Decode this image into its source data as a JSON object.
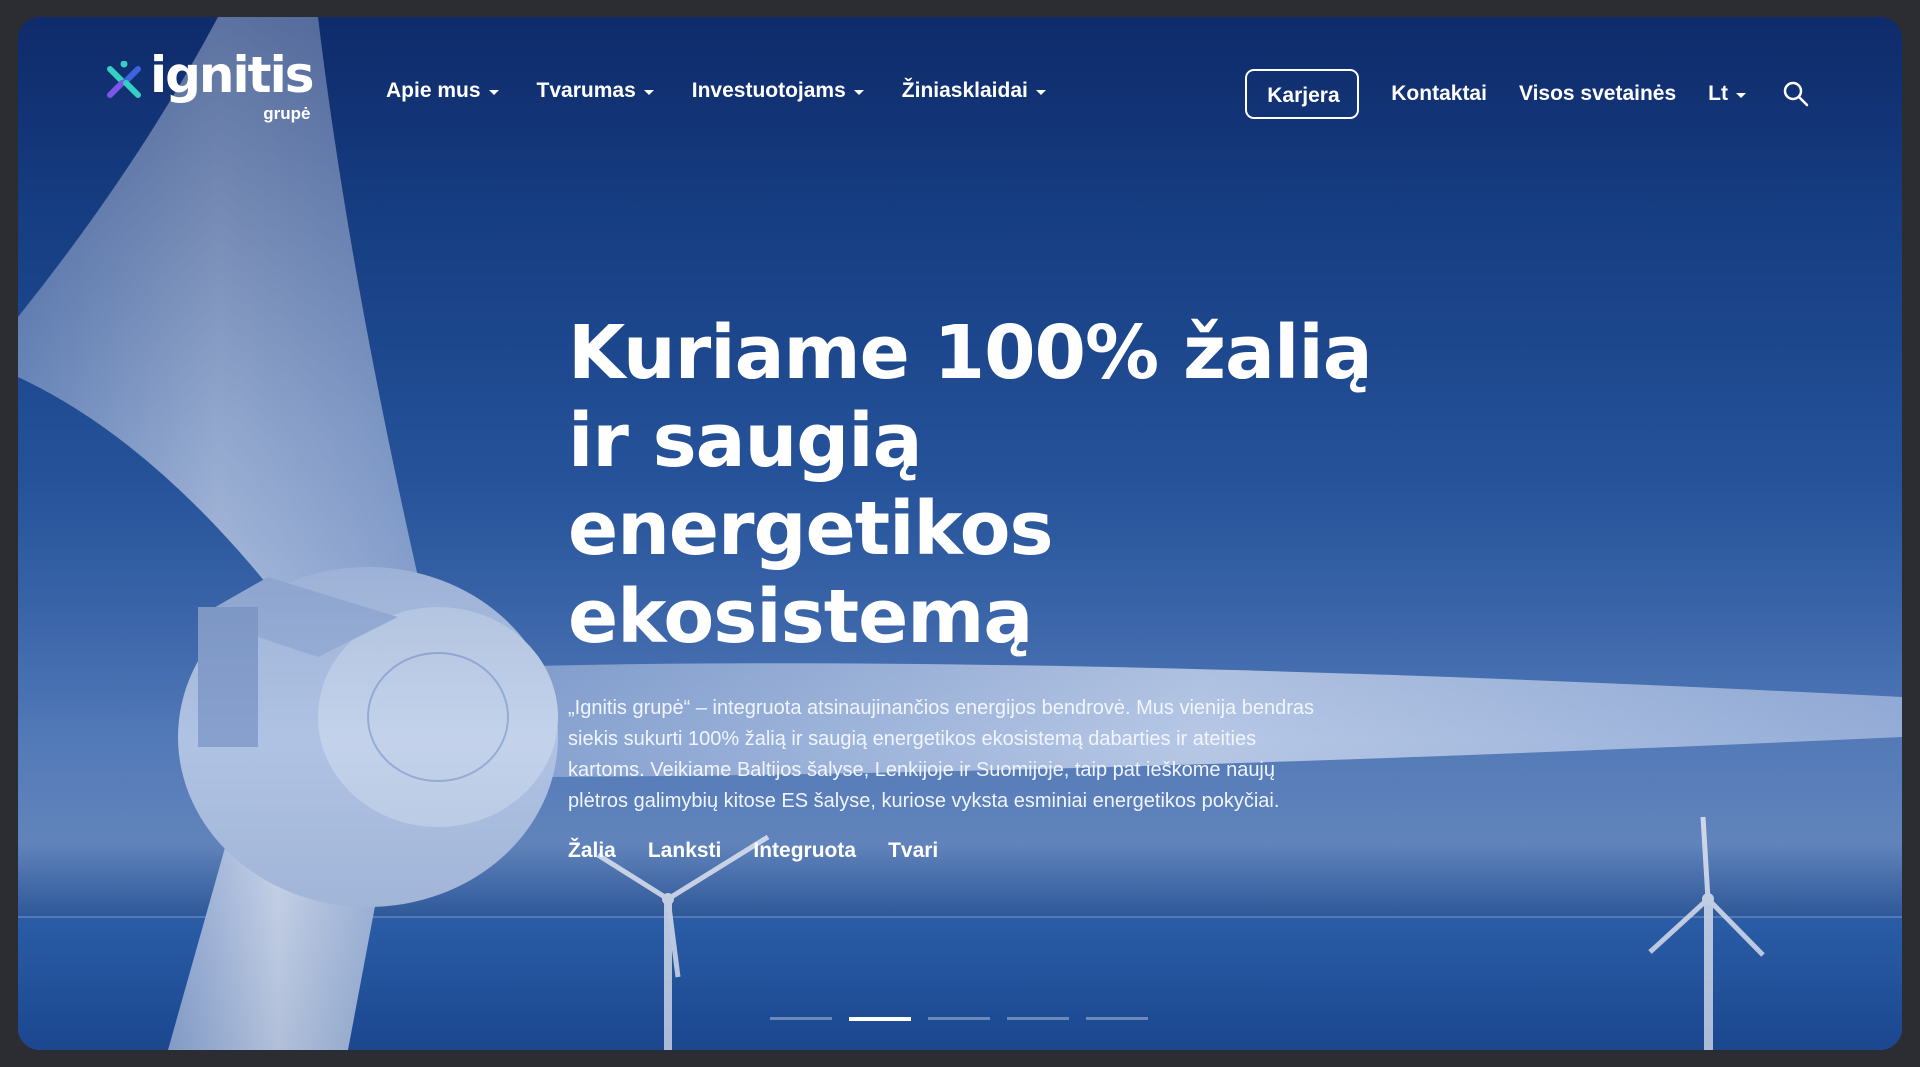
{
  "brand": {
    "name": "ignitis",
    "subtitle": "grupė",
    "colors": {
      "teal": "#35d0c4",
      "blue": "#3c63e0",
      "violet": "#7a57e6"
    }
  },
  "nav": {
    "items": [
      {
        "label": "Apie mus",
        "icon": "chevron-down-icon"
      },
      {
        "label": "Tvarumas",
        "icon": "chevron-down-icon"
      },
      {
        "label": "Investuotojams",
        "icon": "chevron-down-icon"
      },
      {
        "label": "Žiniasklaidai",
        "icon": "chevron-down-icon"
      }
    ],
    "career": "Karjera",
    "contacts": "Kontaktai",
    "all_sites": "Visos svetainės",
    "language": "Lt",
    "search_icon": "search-icon"
  },
  "hero": {
    "headline_lines": [
      "Kuriame 100% žalią",
      "ir saugią energetikos",
      "ekosistemą"
    ],
    "lead_lines": [
      "„Ignitis grupė“ – integruota atsinaujinančios energijos bendrovė. Mus vienija bendras",
      "siekis sukurti 100% žalią ir saugią energetikos ekosistemą dabarties ir ateities",
      "kartoms. Veikiame Baltijos šalyse, Lenkijoje ir Suomijoje, taip pat ieškome naujų",
      "plėtros galimybių kitose ES šalyse, kuriose vyksta esminiai energetikos pokyčiai."
    ],
    "tags": [
      "Žalia",
      "Lanksti",
      "Integruota",
      "Tvari"
    ]
  },
  "carousel": {
    "total": 5,
    "active_index": 1
  },
  "colors": {
    "frame": "#2c2d33",
    "overlay_blue": "#1a4891",
    "text": "#ffffff"
  }
}
